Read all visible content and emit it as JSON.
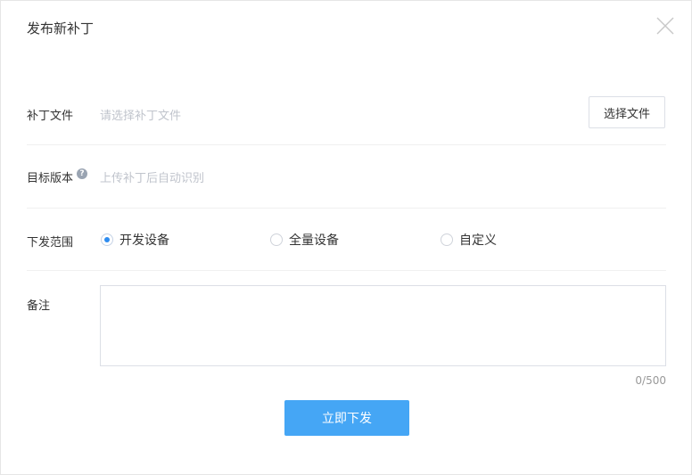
{
  "dialog": {
    "title": "发布新补丁",
    "close_icon": "close-icon"
  },
  "patch_file": {
    "label": "补丁文件",
    "placeholder": "请选择补丁文件",
    "button_label": "选择文件"
  },
  "target_version": {
    "label": "目标版本",
    "help_icon": "question-circle-icon",
    "help_glyph": "?",
    "placeholder": "上传补丁后自动识别"
  },
  "distribution_scope": {
    "label": "下发范围",
    "options": [
      {
        "label": "开发设备",
        "selected": true
      },
      {
        "label": "全量设备",
        "selected": false
      },
      {
        "label": "自定义",
        "selected": false
      }
    ]
  },
  "remarks": {
    "label": "备注",
    "value": "",
    "counter": "0/500"
  },
  "submit": {
    "label": "立即下发"
  },
  "colors": {
    "primary": "#45a6f5",
    "radio_selected": "#2d8cf0",
    "placeholder": "#c0c4cc"
  }
}
